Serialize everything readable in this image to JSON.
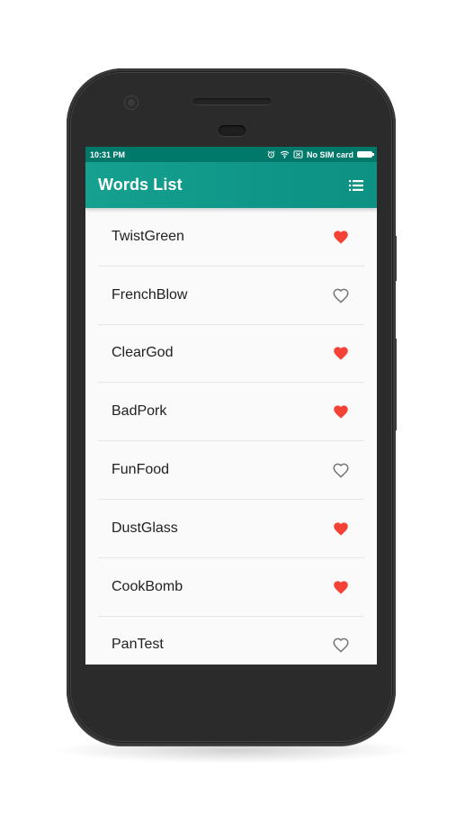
{
  "status_bar": {
    "time": "10:31 PM",
    "carrier": "No SIM card",
    "icons": [
      "alarm-icon",
      "wifi-icon",
      "sim-off-icon",
      "battery-icon"
    ]
  },
  "app_bar": {
    "title": "Words List",
    "menu_icon": "list-icon"
  },
  "words": [
    {
      "word": "TwistGreen",
      "favorite": true
    },
    {
      "word": "FrenchBlow",
      "favorite": false
    },
    {
      "word": "ClearGod",
      "favorite": true
    },
    {
      "word": "BadPork",
      "favorite": true
    },
    {
      "word": "FunFood",
      "favorite": false
    },
    {
      "word": "DustGlass",
      "favorite": true
    },
    {
      "word": "CookBomb",
      "favorite": true
    },
    {
      "word": "PanTest",
      "favorite": false
    }
  ],
  "colors": {
    "primary": "#0f9688",
    "primary_dark": "#00796b",
    "favorite": "#f44336",
    "unfavorite": "#757575"
  }
}
